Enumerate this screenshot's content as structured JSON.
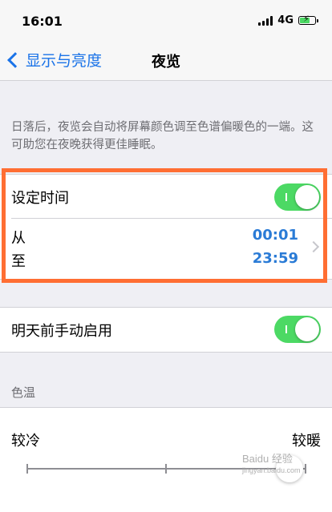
{
  "status": {
    "time": "16:01",
    "network": "4G"
  },
  "nav": {
    "back_label": "显示与亮度",
    "title": "夜览"
  },
  "description": "日落后，夜览会自动将屏幕颜色调至色谱偏暖色的一端。这可助您在夜晚获得更佳睡眠。",
  "schedule": {
    "label": "设定时间",
    "enabled": true,
    "from_label": "从",
    "to_label": "至",
    "from_time": "00:01",
    "to_time": "23:59"
  },
  "manual": {
    "label": "明天前手动启用",
    "enabled": true
  },
  "color_temp": {
    "header": "色温",
    "cold_label": "较冷",
    "warm_label": "较暖",
    "level": 0.94
  },
  "watermark": {
    "brand": "Baidu 经验",
    "url": "jingyan.baidu.com"
  },
  "colors": {
    "accent": "#2a7bd6",
    "toggle_on": "#4cd964",
    "highlight": "#ff6e33"
  }
}
